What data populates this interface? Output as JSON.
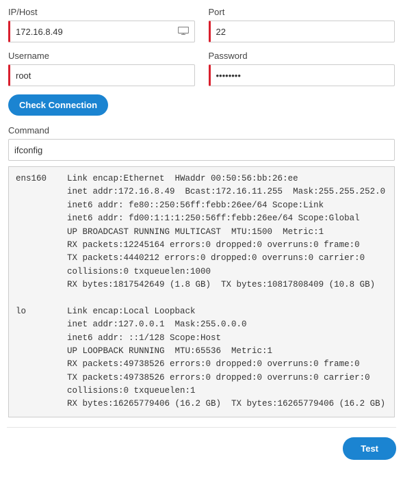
{
  "labels": {
    "ip_host": "IP/Host",
    "port": "Port",
    "username": "Username",
    "password": "Password",
    "command": "Command"
  },
  "values": {
    "ip_host": "172.16.8.49",
    "port": "22",
    "username": "root",
    "password": "••••••••",
    "command": "ifconfig"
  },
  "buttons": {
    "check_connection": "Check Connection",
    "test": "Test"
  },
  "output": "ens160    Link encap:Ethernet  HWaddr 00:50:56:bb:26:ee\n          inet addr:172.16.8.49  Bcast:172.16.11.255  Mask:255.255.252.0\n          inet6 addr: fe80::250:56ff:febb:26ee/64 Scope:Link\n          inet6 addr: fd00:1:1:1:250:56ff:febb:26ee/64 Scope:Global\n          UP BROADCAST RUNNING MULTICAST  MTU:1500  Metric:1\n          RX packets:12245164 errors:0 dropped:0 overruns:0 frame:0\n          TX packets:4440212 errors:0 dropped:0 overruns:0 carrier:0\n          collisions:0 txqueuelen:1000\n          RX bytes:1817542649 (1.8 GB)  TX bytes:10817808409 (10.8 GB)\n\nlo        Link encap:Local Loopback\n          inet addr:127.0.0.1  Mask:255.0.0.0\n          inet6 addr: ::1/128 Scope:Host\n          UP LOOPBACK RUNNING  MTU:65536  Metric:1\n          RX packets:49738526 errors:0 dropped:0 overruns:0 frame:0\n          TX packets:49738526 errors:0 dropped:0 overruns:0 carrier:0\n          collisions:0 txqueuelen:1\n          RX bytes:16265779406 (16.2 GB)  TX bytes:16265779406 (16.2 GB)"
}
